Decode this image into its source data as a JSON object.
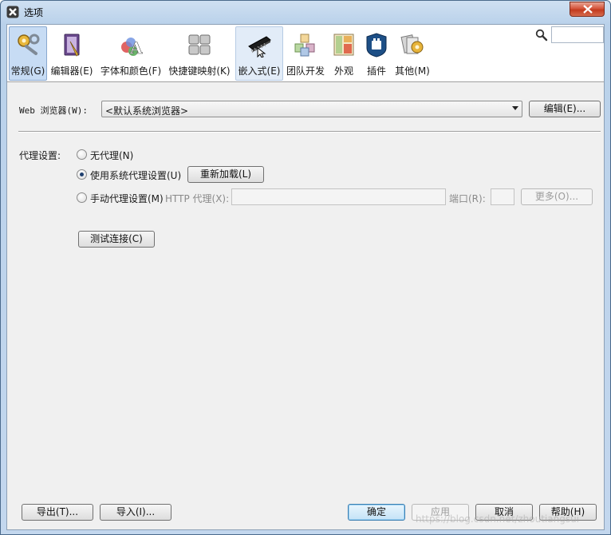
{
  "window": {
    "title": "选项"
  },
  "search": {
    "placeholder": ""
  },
  "categories": [
    {
      "label": "常规(G)",
      "icon": "general-settings-icon"
    },
    {
      "label": "编辑器(E)",
      "icon": "editor-icon"
    },
    {
      "label": "字体和颜色(F)",
      "icon": "fonts-colors-icon"
    },
    {
      "label": "快捷键映射(K)",
      "icon": "keymap-icon"
    },
    {
      "label": "嵌入式(E)",
      "icon": "chip-icon"
    },
    {
      "label": "团队开发",
      "icon": "team-icon"
    },
    {
      "label": "外观",
      "icon": "appearance-icon"
    },
    {
      "label": "插件",
      "icon": "plugin-icon"
    },
    {
      "label": "其他(M)",
      "icon": "misc-icon"
    }
  ],
  "browser": {
    "label": "Web 浏览器(W):",
    "selected": "<默认系统浏览器>",
    "edit_button": "编辑(E)..."
  },
  "proxy": {
    "label": "代理设置:",
    "options": [
      "无代理(N)",
      "使用系统代理设置(U)",
      "手动代理设置(M)"
    ],
    "selected_index": 1,
    "reload_button": "重新加载(L)",
    "http_label": "HTTP 代理(X):",
    "http_value": "",
    "port_label": "端口(R):",
    "port_value": "",
    "more_button": "更多(O)..."
  },
  "test_button": "测试连接(C)",
  "footer": {
    "export_button": "导出(T)...",
    "import_button": "导入(I)...",
    "ok_button": "确定",
    "apply_button": "应用",
    "cancel_button": "取消",
    "help_button": "帮助(H)"
  },
  "watermark": "https://blog.csdn.net/zhoutiangsui",
  "colors": {
    "selected_tab": "#c7dcf4",
    "close_button": "#c9452a"
  }
}
